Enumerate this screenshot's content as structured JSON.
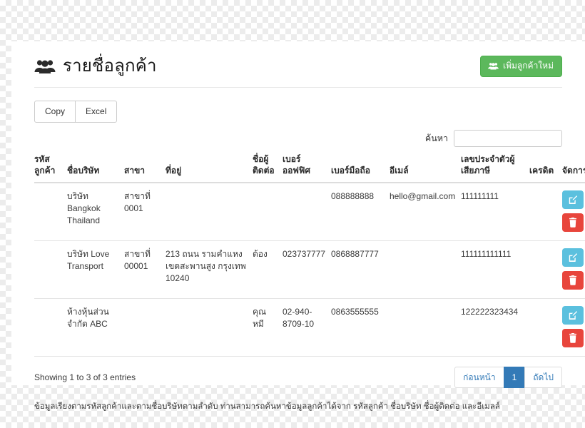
{
  "header": {
    "title": "รายชื่อลูกค้า",
    "icon": "users-icon",
    "add_button": {
      "label": "เพิ่มลูกค้าใหม่",
      "icon": "users-icon",
      "color": "#5cb85c"
    }
  },
  "toolbar": {
    "copy_label": "Copy",
    "excel_label": "Excel"
  },
  "search": {
    "label": "ค้นหา",
    "value": "",
    "placeholder": ""
  },
  "table": {
    "columns": [
      "รหัสลูกค้า",
      "ชื่อบริษัท",
      "สาขา",
      "ที่อยู่",
      "ชื่อผู้ติดต่อ",
      "เบอร์ออฟฟิศ",
      "เบอร์มือถือ",
      "อีเมล์",
      "เลขประจำตัวผู้เสียภาษี",
      "เครดิต",
      "จัดการ"
    ],
    "rows": [
      {
        "code": "",
        "company": "บริษัท Bangkok Thailand",
        "branch": "สาขาที่ 0001",
        "address": "",
        "contact": "",
        "office": "",
        "mobile": "088888888",
        "email": "hello@gmail.com",
        "tax_id": "111111111",
        "credit": "",
        "edit_icon": "edit-pencil-icon",
        "delete_icon": "trash-icon"
      },
      {
        "code": "",
        "company": "บริษัท Love Transport",
        "branch": "สาขาที่ 00001",
        "address": "213 ถนน รามคำแหง เขตสะพานสูง กรุงเทพ 10240",
        "contact": "ต้อง",
        "office": "023737777",
        "mobile": "0868887777",
        "email": "",
        "tax_id": "111111111111",
        "credit": "",
        "edit_icon": "edit-pencil-icon",
        "delete_icon": "trash-icon"
      },
      {
        "code": "",
        "company": "ห้างหุ้นส่วนจำกัด ABC",
        "branch": "",
        "address": "",
        "contact": "คุณ หมี",
        "office": "02-940-8709-10",
        "mobile": "0863555555",
        "email": "",
        "tax_id": "122222323434",
        "credit": "",
        "edit_icon": "edit-pencil-icon",
        "delete_icon": "trash-icon"
      }
    ]
  },
  "footer": {
    "entries_info": "Showing 1 to 3 of 3 entries",
    "pagination": {
      "previous": "ก่อนหน้า",
      "current_page": "1",
      "next": "ถัดไป"
    },
    "note": "ข้อมูลเรียงตามรหัสลูกค้าและตามชื่อบริษัทตามลำดับ ท่านสามารถค้นหาข้อมูลลูกค้าได้จาก รหัสลูกค้า ชื่อบริษัท ชื่อผู้ติดต่อ และอีเมลล์"
  },
  "colors": {
    "accent_green": "#5cb85c",
    "accent_blue": "#337ab7",
    "edit_blue": "#5bc0de",
    "delete_red": "#e8453c"
  }
}
